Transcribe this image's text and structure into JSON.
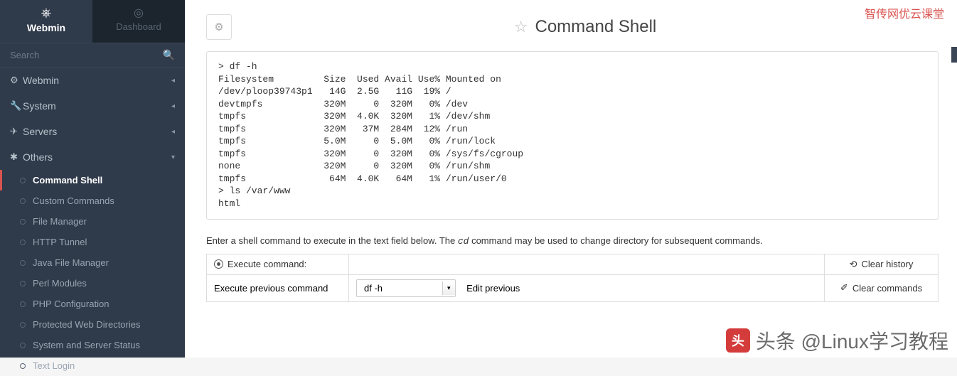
{
  "watermarks": {
    "top_right": "智传网优云课堂",
    "bottom_right": "头条 @Linux学习教程",
    "logo_glyph": "头"
  },
  "sidebar": {
    "brand": "Webmin",
    "dashboard": "Dashboard",
    "search_placeholder": "Search",
    "sections": [
      {
        "icon": "⚙",
        "label": "Webmin",
        "caret": "◂"
      },
      {
        "icon": "🔧",
        "label": "System",
        "caret": "◂"
      },
      {
        "icon": "✈",
        "label": "Servers",
        "caret": "◂"
      },
      {
        "icon": "✱",
        "label": "Others",
        "caret": "▾",
        "items": [
          {
            "label": "Command Shell",
            "active": true
          },
          {
            "label": "Custom Commands"
          },
          {
            "label": "File Manager"
          },
          {
            "label": "HTTP Tunnel"
          },
          {
            "label": "Java File Manager"
          },
          {
            "label": "Perl Modules"
          },
          {
            "label": "PHP Configuration"
          },
          {
            "label": "Protected Web Directories"
          },
          {
            "label": "System and Server Status"
          },
          {
            "label": "Text Login"
          }
        ]
      }
    ]
  },
  "page": {
    "title": "Command Shell",
    "terminal_output": "> df -h\nFilesystem         Size  Used Avail Use% Mounted on\n/dev/ploop39743p1   14G  2.5G   11G  19% /\ndevtmpfs           320M     0  320M   0% /dev\ntmpfs              320M  4.0K  320M   1% /dev/shm\ntmpfs              320M   37M  284M  12% /run\ntmpfs              5.0M     0  5.0M   0% /run/lock\ntmpfs              320M     0  320M   0% /sys/fs/cgroup\nnone               320M     0  320M   0% /run/shm\ntmpfs               64M  4.0K   64M   1% /run/user/0\n> ls /var/www\nhtml",
    "help_pre": "Enter a shell command to execute in the text field below. The ",
    "help_code": "cd",
    "help_post": " command may be used to change directory for subsequent commands.",
    "execute_label": "Execute command:",
    "clear_history": "Clear history",
    "prev_label": "Execute previous command",
    "prev_selected": "df -h",
    "edit_prev": "Edit previous",
    "clear_commands": "Clear commands",
    "history_icon": "⟲",
    "broom_icon": "✐"
  }
}
